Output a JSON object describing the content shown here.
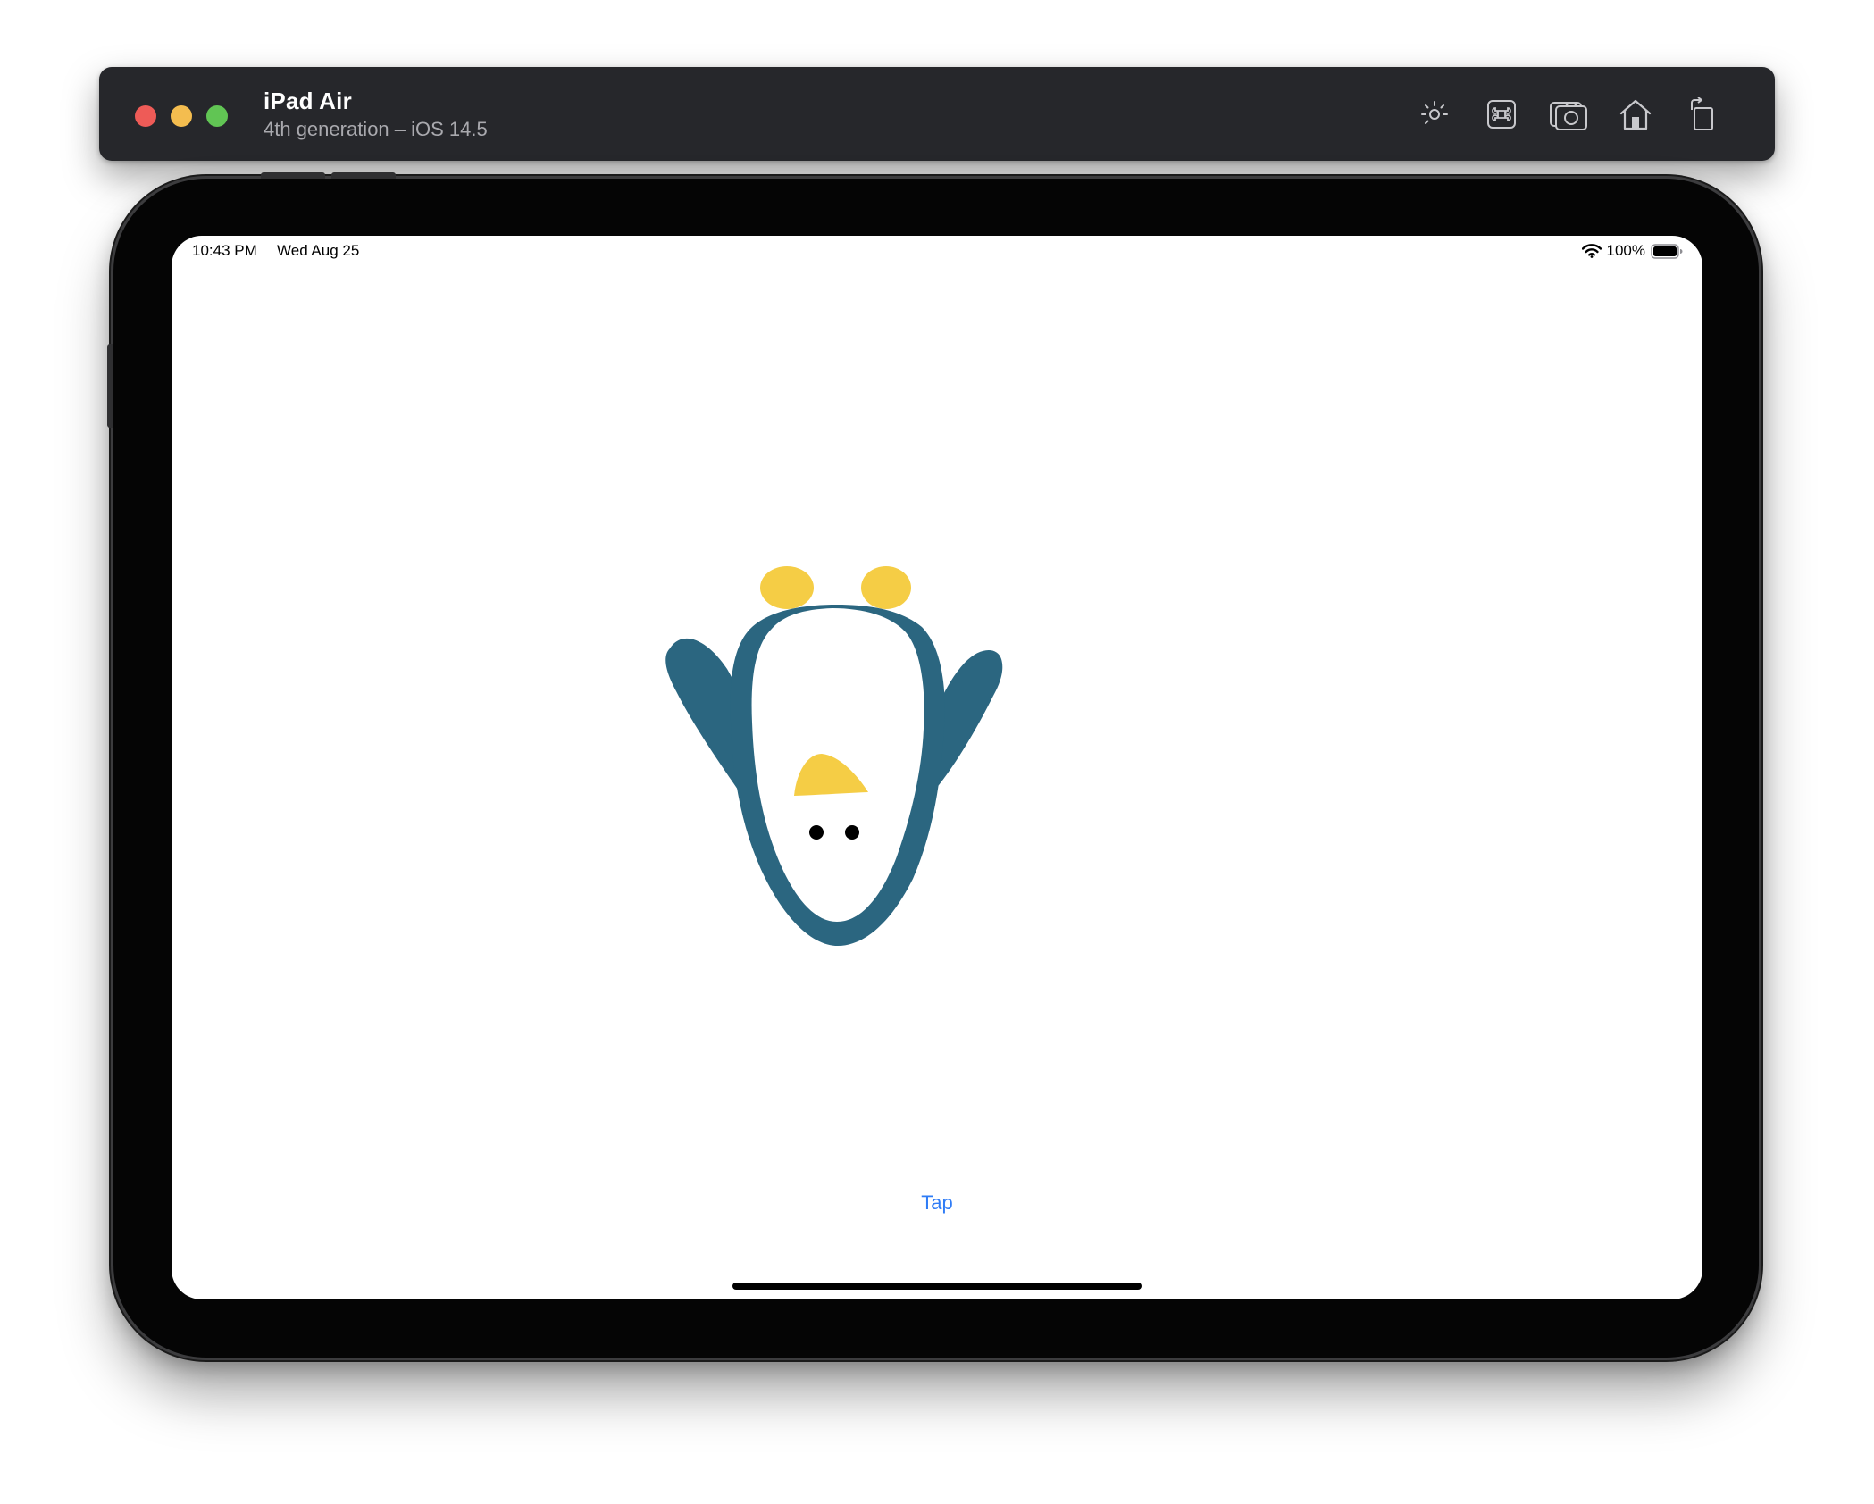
{
  "simulator": {
    "device_name": "iPad Air",
    "device_subtitle": "4th generation – iOS 14.5",
    "toolbar_icons": [
      "brightness-icon",
      "command-key-icon",
      "screenshot-camera-icon",
      "home-icon",
      "rotate-icon"
    ],
    "traffic_lights": {
      "close_color": "#ee5b57",
      "minimize_color": "#f4bd4f",
      "zoom_color": "#61c554"
    }
  },
  "status_bar": {
    "time": "10:43 PM",
    "date": "Wed Aug 25",
    "battery_percent": "100%",
    "wifi_icon": "wifi-icon",
    "battery_icon": "battery-full-icon"
  },
  "app": {
    "tap_button_label": "Tap",
    "accent_color": "#2f7cf6",
    "illustration": {
      "name": "upside-down penguin",
      "body_color": "#2b6680",
      "belly_color": "#ffffff",
      "beak_feet_color": "#f5cd45",
      "eye_color": "#000000"
    }
  }
}
